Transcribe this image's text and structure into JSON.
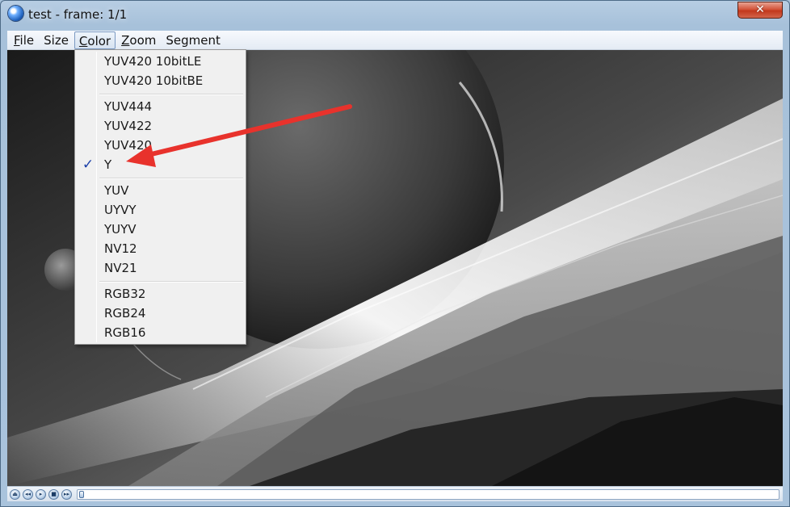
{
  "window": {
    "title": "test - frame: 1/1",
    "close_label": "✕"
  },
  "menubar": {
    "items": [
      {
        "mnemonic": "F",
        "rest": "ile"
      },
      {
        "mnemonic": "",
        "rest": "Size"
      },
      {
        "mnemonic": "C",
        "rest": "olor"
      },
      {
        "mnemonic": "Z",
        "rest": "oom"
      },
      {
        "mnemonic": "",
        "rest": "Segment"
      }
    ],
    "active_menu": "Color"
  },
  "color_menu": {
    "groups": [
      [
        "YUV420 10bitLE",
        "YUV420 10bitBE"
      ],
      [
        "YUV444",
        "YUV422",
        "YUV420",
        "Y"
      ],
      [
        "YUV",
        "UYVY",
        "YUYV",
        "NV12",
        "NV21"
      ],
      [
        "RGB32",
        "RGB24",
        "RGB16"
      ]
    ],
    "checked_item": "Y",
    "check_glyph": "✓"
  },
  "annotation": {
    "arrow_color": "#e8322c"
  },
  "controls": {
    "buttons": [
      {
        "icon": "eject-icon",
        "glyph": "⏏"
      },
      {
        "icon": "rewind-icon",
        "glyph": "◂◂"
      },
      {
        "icon": "play-icon",
        "glyph": "▸"
      },
      {
        "icon": "stop-icon",
        "glyph": "■"
      },
      {
        "icon": "fast-forward-icon",
        "glyph": "▸▸"
      }
    ],
    "position_fraction": 0
  }
}
